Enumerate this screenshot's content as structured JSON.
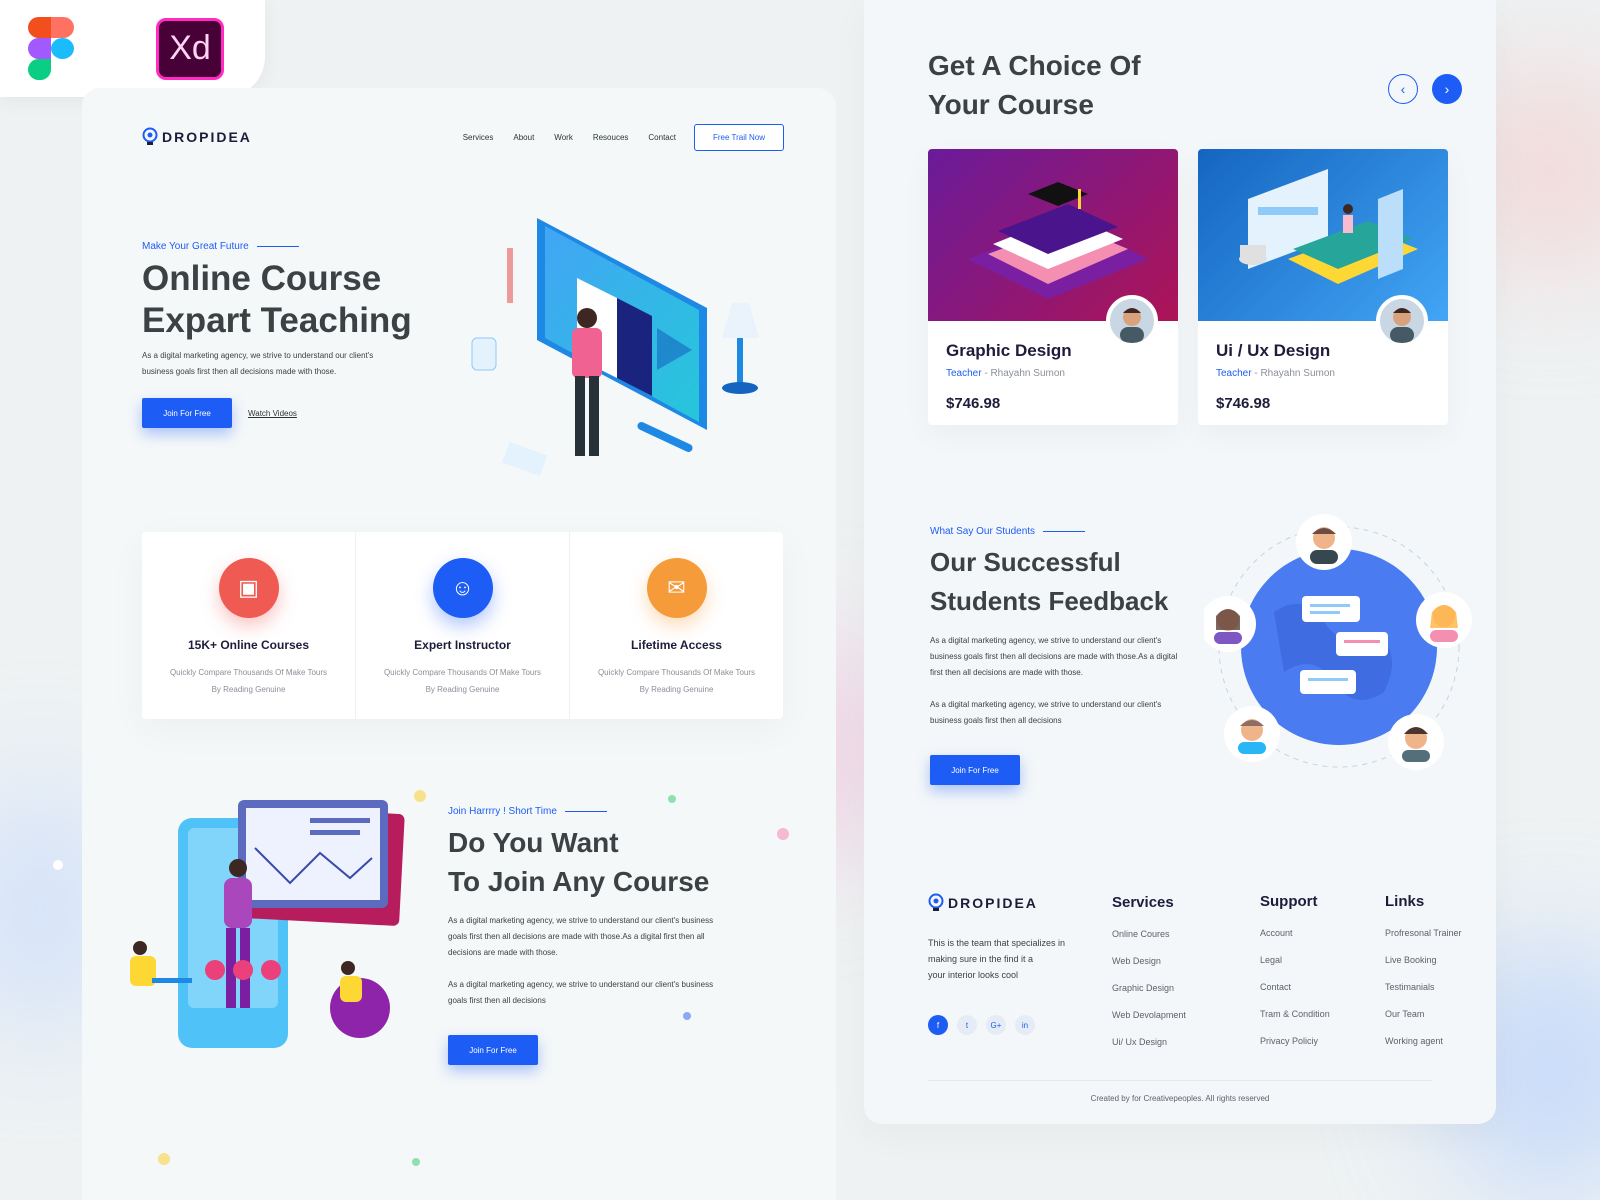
{
  "tools": {
    "figma_label": "",
    "xd_label": "Xd"
  },
  "colors": {
    "primary": "#1d5cf5",
    "heading": "#3c4144",
    "dark": "#1d1d3b"
  },
  "nav": {
    "logo": "DROPIDEA",
    "links": [
      "Services",
      "About",
      "Work",
      "Resouces",
      "Contact"
    ],
    "cta": "Free Trail Now"
  },
  "hero": {
    "eyebrow": "Make Your Great Future",
    "title_line1": "Online Course",
    "title_line2": "Expart Teaching",
    "desc_line1": "As a digital marketing agency, we strive to understand our client's",
    "desc_line2": "business goals first then all decisions  made with those.",
    "primary_btn": "Join For Free",
    "secondary_link": "Watch Videos"
  },
  "features": [
    {
      "title": "15K+ Online Courses",
      "desc": "Quickly Compare Thousands Of Make Tours By Reading Genuine",
      "icon": "presentation-icon",
      "color": "#ef5a52"
    },
    {
      "title": "Expert Instructor",
      "desc": "Quickly Compare Thousands Of Make Tours By Reading Genuine",
      "icon": "instructor-icon",
      "color": "#1d5cf5"
    },
    {
      "title": "Lifetime Access",
      "desc": "Quickly Compare Thousands Of Make Tours By Reading Genuine",
      "icon": "chat-lock-icon",
      "color": "#f59b3a"
    }
  ],
  "join": {
    "eyebrow": "Join Harrrry !  Short Time",
    "title_line1": "Do You Want",
    "title_line2": "To Join Any Course",
    "p1_line1": "As a digital marketing agency, we strive to understand our client's business",
    "p1_line2": "goals first then all decisions are made with those.As a digital  first then all",
    "p1_line3": "decisions are made with those.",
    "p2_line1": "As a digital marketing agency, we strive to understand our client's business",
    "p2_line2": "goals first then all decisions",
    "btn": "Join For Free"
  },
  "courses": {
    "title_line1": "Get A Choice Of",
    "title_line2": "Your Course",
    "items": [
      {
        "title": "Graphic Design",
        "teacher_label": "Teacher",
        "teacher_name": " - Rhayahn Sumon",
        "price": "$746.98"
      },
      {
        "title": "Ui / Ux Design",
        "teacher_label": "Teacher",
        "teacher_name": " - Rhayahn Sumon",
        "price": "$746.98"
      }
    ]
  },
  "feedback": {
    "eyebrow": "What Say Our Students",
    "title_line1": "Our Successful",
    "title_line2": "Students Feedback",
    "p1_line1": "As a digital marketing agency, we strive to understand our client's",
    "p1_line2": "business goals first then all decisions are made with those.As a digital",
    "p1_line3": "first then all decisions are made with those.",
    "p2_line1": "As a digital marketing agency, we strive to understand our client's",
    "p2_line2": "business goals first then all decisions",
    "btn": "Join For Free"
  },
  "footer": {
    "logo": "DROPIDEA",
    "about_line1": "This is the team that specializes in",
    "about_line2": "making sure  in the find it a",
    "about_line3": "your interior looks cool",
    "social": [
      "f",
      "t",
      "G+",
      "in"
    ],
    "services_title": "Services",
    "services": [
      "Online Coures",
      "Web Design",
      "Graphic Design",
      "Web Devolapment",
      "Ui/ Ux Design"
    ],
    "support_title": "Support",
    "support": [
      "Account",
      "Legal",
      "Contact",
      "Tram & Condition",
      "Privacy Policiy"
    ],
    "links_title": "Links",
    "links": [
      "Profresonal Trainer",
      "Live Booking",
      "Testimanials",
      "Our Team",
      "Working agent"
    ],
    "copyright": "Created  by  for Creativepeoples. All rights reserved"
  }
}
